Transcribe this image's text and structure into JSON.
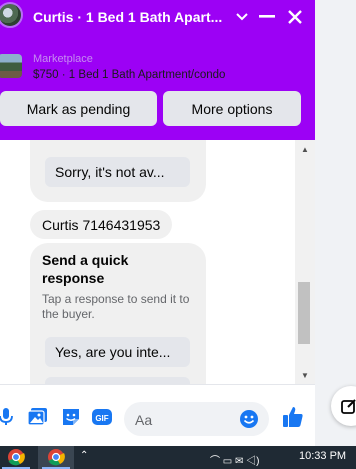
{
  "header": {
    "title": "Curtis · 1 Bed 1 Bath Apart...",
    "icons": [
      "chevron-down-icon",
      "minimize-icon",
      "close-icon"
    ]
  },
  "marketplace": {
    "label": "Marketplace",
    "item": "$750 · 1 Bed 1 Bath Apartment/condo",
    "buttons": {
      "pending": "Mark as pending",
      "more": "More options"
    }
  },
  "chat": {
    "prev_reply": "...",
    "sorry_reply": "Sorry, it's not av...",
    "message": "Curtis 7146431953",
    "quick_reply_card": {
      "title": "Send a quick response",
      "subtitle": "Tap a response to send it to the buyer.",
      "option1": "Yes, are you inte...",
      "option2": ""
    }
  },
  "composer": {
    "placeholder": "Aa",
    "gif_label": "GIF"
  },
  "taskbar": {
    "time": "10:33 PM"
  },
  "colors": {
    "header_bg": "#9c01f5",
    "accent_blue": "#1877f2",
    "bubble_bg": "#f0f0f0",
    "button_bg": "#e4e6eb"
  }
}
